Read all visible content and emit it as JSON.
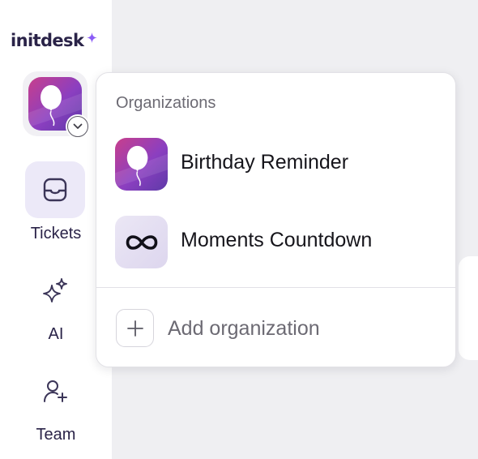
{
  "app": {
    "brand": "initdesk"
  },
  "sidebar": {
    "org_switcher": {
      "current": "Birthday Reminder",
      "avatar_icon": "balloon-icon"
    },
    "nav": [
      {
        "label": "Tickets",
        "icon": "inbox-icon",
        "active": true
      },
      {
        "label": "AI",
        "icon": "sparkles-icon",
        "active": false
      },
      {
        "label": "Team",
        "icon": "user-plus-icon",
        "active": false
      }
    ]
  },
  "org_menu": {
    "heading": "Organizations",
    "items": [
      {
        "name": "Birthday Reminder",
        "icon": "balloon-icon"
      },
      {
        "name": "Moments Countdown",
        "icon": "infinity-icon"
      }
    ],
    "add_label": "Add organization"
  },
  "colors": {
    "brand": "#2a2348",
    "accent_purple": "#7b3fc4",
    "accent_pink": "#c63d8f",
    "active_tile": "#ece9f8",
    "background": "#efeff2"
  }
}
